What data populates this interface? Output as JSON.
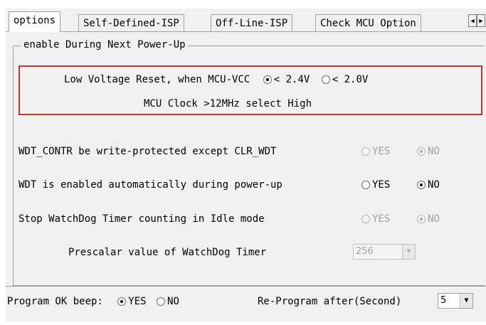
{
  "tabs": [
    {
      "label": "options",
      "active": true
    },
    {
      "label": "Self-Defined-ISP",
      "active": false
    },
    {
      "label": "Off-Line-ISP",
      "active": false
    },
    {
      "label": "Check MCU Option",
      "active": false
    }
  ],
  "tab_scroll": {
    "left": "◀",
    "right": "▶"
  },
  "group": {
    "legend": "enable During Next Power-Up",
    "lvr": {
      "label": "Low Voltage Reset, when MCU-VCC",
      "opt1": "< 2.4V",
      "opt2": "< 2.0V",
      "selected": "< 2.4V"
    },
    "clock_note": "MCU Clock >12MHz select High",
    "wdt_protect": {
      "label": "WDT_CONTR be write-protected except CLR_WDT",
      "yes": "YES",
      "no": "NO",
      "selected": "NO",
      "enabled": false
    },
    "wdt_enable": {
      "label": "WDT is enabled automatically during power-up",
      "yes": "YES",
      "no": "NO",
      "selected": "NO",
      "enabled": true
    },
    "wdt_idle": {
      "label": "Stop WatchDog Timer counting in Idle mode",
      "yes": "YES",
      "no": "NO",
      "selected": "NO",
      "enabled": false
    },
    "prescalar": {
      "label": "Prescalar value of WatchDog Timer",
      "value": "256",
      "enabled": false
    }
  },
  "footer": {
    "beep_label": "Program OK beep:",
    "beep_yes": "YES",
    "beep_no": "NO",
    "beep_selected": "YES",
    "reprogram_label": "Re-Program after(Second)",
    "reprogram_value": "5"
  },
  "colors": {
    "highlight_border": "#c83232",
    "panel_bg": "#f0f0f0"
  }
}
